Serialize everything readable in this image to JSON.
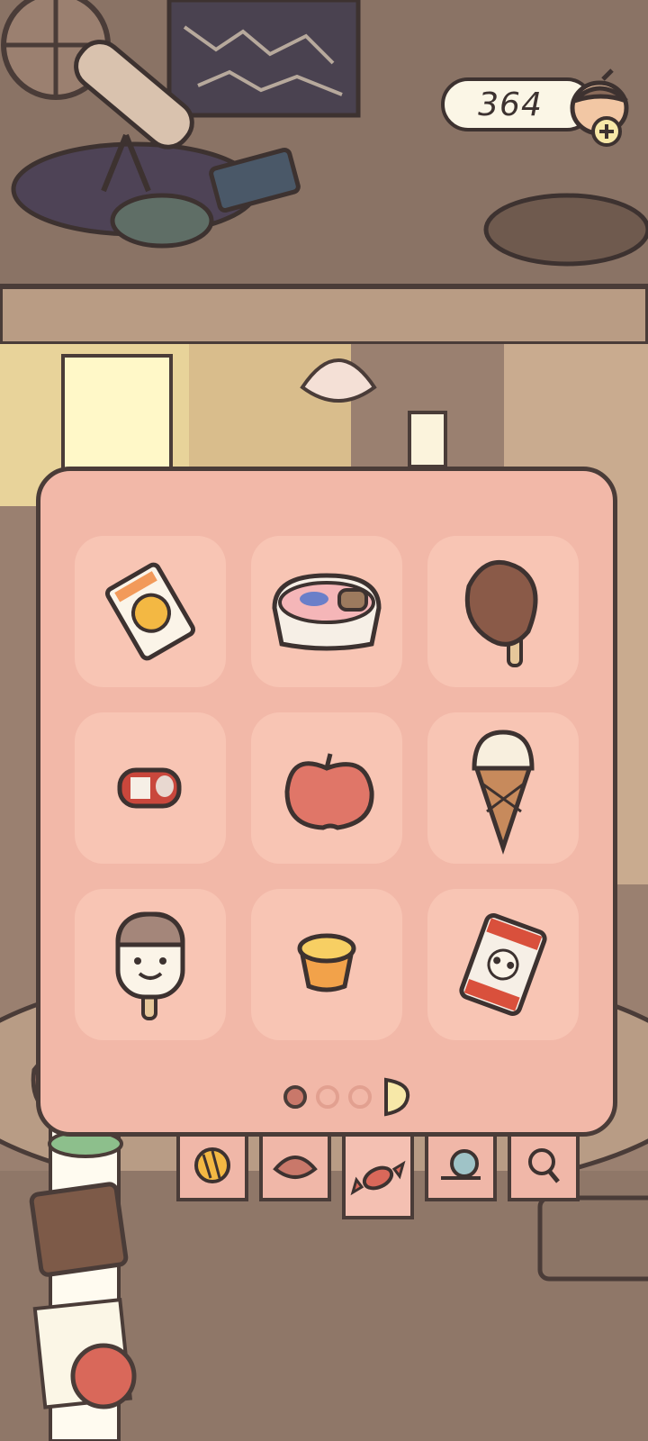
{
  "hud": {
    "coin_count": "364",
    "coin_icon": "acorn-coin-icon",
    "add_icon": "plus-icon"
  },
  "inventory": {
    "items": [
      {
        "name": "snack-bag-icon"
      },
      {
        "name": "ice-cream-tub-icon"
      },
      {
        "name": "chocolate-popsicle-icon"
      },
      {
        "name": "soda-can-icon"
      },
      {
        "name": "apple-icon"
      },
      {
        "name": "ice-cream-cone-icon"
      },
      {
        "name": "smiley-popsicle-icon"
      },
      {
        "name": "pudding-cup-icon"
      },
      {
        "name": "panda-snack-bag-icon"
      }
    ],
    "pager": {
      "current_page": 1,
      "total_pages": 3
    }
  },
  "tabs": [
    {
      "name": "yarn-ball-icon",
      "active": false
    },
    {
      "name": "leaf-icon",
      "active": false
    },
    {
      "name": "candy-icon",
      "active": true
    },
    {
      "name": "snail-shell-icon",
      "active": false
    },
    {
      "name": "magnifier-icon",
      "active": false
    }
  ],
  "colors": {
    "panel_bg": "#f2b8a8",
    "slot_bg": "#f8c5b4",
    "outline": "#4a3c38",
    "room_bg": "#8f7768"
  }
}
